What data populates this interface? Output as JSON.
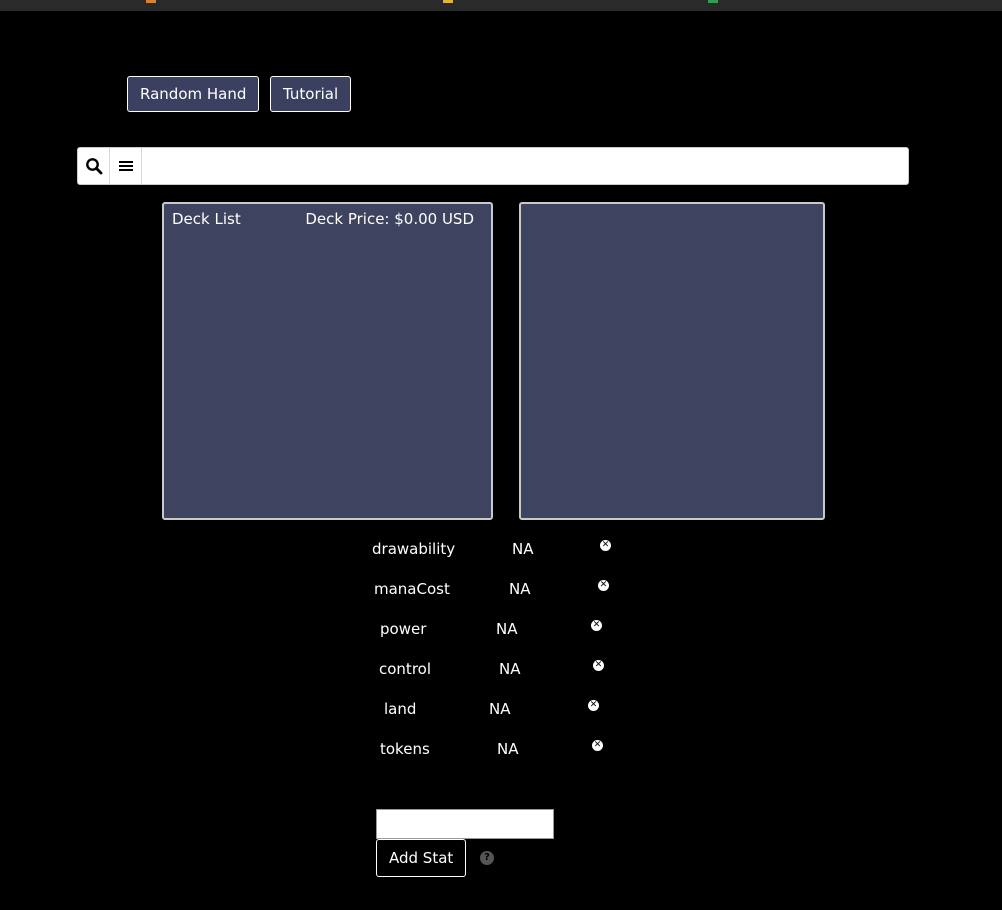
{
  "toolbar": {
    "random_hand_label": "Random Hand",
    "tutorial_label": "Tutorial"
  },
  "search": {
    "value": "",
    "search_icon": "search-icon",
    "menu_icon": "menu-icon"
  },
  "deck_panel": {
    "title": "Deck List",
    "price_label": "Deck Price: $0.00 USD"
  },
  "stats": [
    {
      "name": "drawability",
      "value": "NA"
    },
    {
      "name": "manaCost",
      "value": "NA"
    },
    {
      "name": "power",
      "value": "NA"
    },
    {
      "name": "control",
      "value": "NA"
    },
    {
      "name": "land",
      "value": "NA"
    },
    {
      "name": "tokens",
      "value": "NA"
    }
  ],
  "add_stat": {
    "input_value": "",
    "button_label": "Add Stat",
    "help_icon": "question-icon"
  },
  "colors": {
    "background": "#000000",
    "panel": "#3e435f",
    "button": "#3b4060"
  }
}
